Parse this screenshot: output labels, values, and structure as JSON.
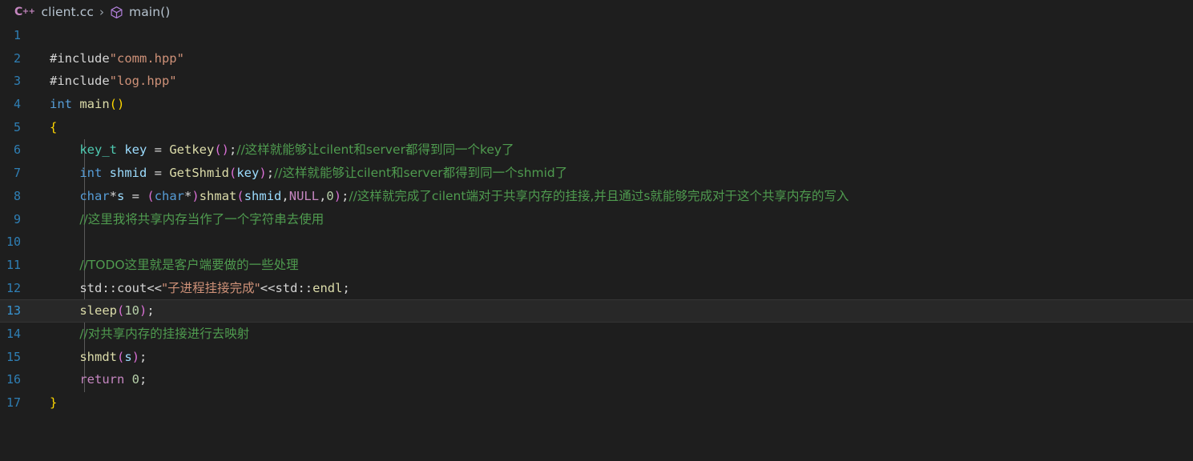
{
  "breadcrumb": {
    "file_icon": "cpp-file-icon",
    "file_name": "client.cc",
    "separator": "›",
    "symbol_icon": "cube-symbol-icon",
    "symbol_name": "main()"
  },
  "editor": {
    "language": "cpp",
    "active_line": 13,
    "colors": {
      "background": "#1e1e1e",
      "active_line_background": "#282828",
      "line_number": "#2f7fb5",
      "active_line_number": "#3794d2",
      "comment": "#4f9b4f",
      "string": "#ce9178",
      "keyword": "#569cd6",
      "type": "#4ec9b0",
      "variable": "#9cdcfe",
      "function": "#dcdcaa",
      "paren": "#da70d6",
      "brace": "#ffd700",
      "number": "#b5cea8",
      "constant": "#c586c0",
      "plain": "#d4d4d4"
    },
    "lines": [
      {
        "n": "1",
        "tokens": []
      },
      {
        "n": "2",
        "tokens": [
          {
            "t": "#include",
            "c": "t-directive"
          },
          {
            "t": "\"comm.hpp\"",
            "c": "t-string"
          }
        ]
      },
      {
        "n": "3",
        "tokens": [
          {
            "t": "#include",
            "c": "t-directive"
          },
          {
            "t": "\"log.hpp\"",
            "c": "t-string"
          }
        ]
      },
      {
        "n": "4",
        "tokens": [
          {
            "t": "int",
            "c": "t-keyword"
          },
          {
            "t": " ",
            "c": "t-plain"
          },
          {
            "t": "main",
            "c": "t-func"
          },
          {
            "t": "()",
            "c": "t-brace"
          }
        ]
      },
      {
        "n": "5",
        "tokens": [
          {
            "t": "{",
            "c": "t-brace"
          }
        ]
      },
      {
        "n": "6",
        "tokens": [
          {
            "t": "    ",
            "c": "t-plain"
          },
          {
            "t": "key_t",
            "c": "t-type"
          },
          {
            "t": " ",
            "c": "t-plain"
          },
          {
            "t": "key",
            "c": "t-var"
          },
          {
            "t": " = ",
            "c": "t-op"
          },
          {
            "t": "Getkey",
            "c": "t-func"
          },
          {
            "t": "()",
            "c": "t-paren"
          },
          {
            "t": ";",
            "c": "t-plain"
          },
          {
            "t": "//这样就能够让cilent和server都得到同一个key了",
            "c": "t-comment cjk"
          }
        ]
      },
      {
        "n": "7",
        "tokens": [
          {
            "t": "    ",
            "c": "t-plain"
          },
          {
            "t": "int",
            "c": "t-keyword"
          },
          {
            "t": " ",
            "c": "t-plain"
          },
          {
            "t": "shmid",
            "c": "t-var"
          },
          {
            "t": " = ",
            "c": "t-op"
          },
          {
            "t": "GetShmid",
            "c": "t-func"
          },
          {
            "t": "(",
            "c": "t-paren"
          },
          {
            "t": "key",
            "c": "t-var"
          },
          {
            "t": ")",
            "c": "t-paren"
          },
          {
            "t": ";",
            "c": "t-plain"
          },
          {
            "t": "//这样就能够让cilent和server都得到同一个shmid了",
            "c": "t-comment cjk"
          }
        ]
      },
      {
        "n": "8",
        "tokens": [
          {
            "t": "    ",
            "c": "t-plain"
          },
          {
            "t": "char",
            "c": "t-keyword"
          },
          {
            "t": "*",
            "c": "t-op"
          },
          {
            "t": "s",
            "c": "t-var"
          },
          {
            "t": " = ",
            "c": "t-op"
          },
          {
            "t": "(",
            "c": "t-paren"
          },
          {
            "t": "char",
            "c": "t-keyword"
          },
          {
            "t": "*",
            "c": "t-op"
          },
          {
            "t": ")",
            "c": "t-paren"
          },
          {
            "t": "shmat",
            "c": "t-func"
          },
          {
            "t": "(",
            "c": "t-paren"
          },
          {
            "t": "shmid",
            "c": "t-var"
          },
          {
            "t": ",",
            "c": "t-plain"
          },
          {
            "t": "NULL",
            "c": "t-const"
          },
          {
            "t": ",",
            "c": "t-plain"
          },
          {
            "t": "0",
            "c": "t-number"
          },
          {
            "t": ")",
            "c": "t-paren"
          },
          {
            "t": ";",
            "c": "t-plain"
          },
          {
            "t": "//这样就完成了cilent端对于共享内存的挂接,并且通过s就能够完成对于这个共享内存的写入",
            "c": "t-comment cjk"
          }
        ]
      },
      {
        "n": "9",
        "tokens": [
          {
            "t": "    ",
            "c": "t-plain"
          },
          {
            "t": "//这里我将共享内存当作了一个字符串去使用",
            "c": "t-comment cjk"
          }
        ]
      },
      {
        "n": "10",
        "tokens": []
      },
      {
        "n": "11",
        "tokens": [
          {
            "t": "    ",
            "c": "t-plain"
          },
          {
            "t": "//TODO这里就是客户端要做的一些处理",
            "c": "t-comment cjk"
          }
        ]
      },
      {
        "n": "12",
        "tokens": [
          {
            "t": "    ",
            "c": "t-plain"
          },
          {
            "t": "std",
            "c": "t-plain"
          },
          {
            "t": "::",
            "c": "t-plain"
          },
          {
            "t": "cout",
            "c": "t-plain"
          },
          {
            "t": "<<",
            "c": "t-op"
          },
          {
            "t": "\"子进程挂接完成\"",
            "c": "t-string cjk"
          },
          {
            "t": "<<",
            "c": "t-op"
          },
          {
            "t": "std",
            "c": "t-plain"
          },
          {
            "t": "::",
            "c": "t-plain"
          },
          {
            "t": "endl",
            "c": "t-func"
          },
          {
            "t": ";",
            "c": "t-plain"
          }
        ]
      },
      {
        "n": "13",
        "active": true,
        "tokens": [
          {
            "t": "    ",
            "c": "t-plain"
          },
          {
            "t": "sleep",
            "c": "t-func"
          },
          {
            "t": "(",
            "c": "t-paren"
          },
          {
            "t": "10",
            "c": "t-number"
          },
          {
            "t": ")",
            "c": "t-paren"
          },
          {
            "t": ";",
            "c": "t-plain"
          }
        ]
      },
      {
        "n": "14",
        "tokens": [
          {
            "t": "    ",
            "c": "t-plain"
          },
          {
            "t": "//对共享内存的挂接进行去映射",
            "c": "t-comment cjk"
          }
        ]
      },
      {
        "n": "15",
        "tokens": [
          {
            "t": "    ",
            "c": "t-plain"
          },
          {
            "t": "shmdt",
            "c": "t-func"
          },
          {
            "t": "(",
            "c": "t-paren"
          },
          {
            "t": "s",
            "c": "t-var"
          },
          {
            "t": ")",
            "c": "t-paren"
          },
          {
            "t": ";",
            "c": "t-plain"
          }
        ]
      },
      {
        "n": "16",
        "tokens": [
          {
            "t": "    ",
            "c": "t-plain"
          },
          {
            "t": "return",
            "c": "t-const"
          },
          {
            "t": " ",
            "c": "t-plain"
          },
          {
            "t": "0",
            "c": "t-number"
          },
          {
            "t": ";",
            "c": "t-plain"
          }
        ]
      },
      {
        "n": "17",
        "tokens": [
          {
            "t": "}",
            "c": "t-brace"
          }
        ]
      }
    ]
  }
}
